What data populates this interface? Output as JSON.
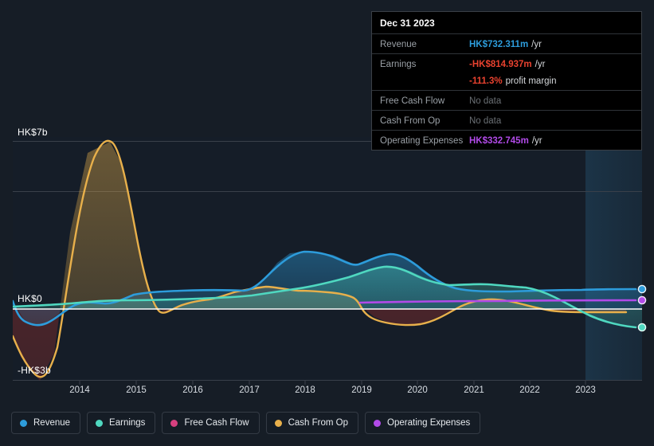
{
  "axes": {
    "y_labels": [
      {
        "text": "HK$7b",
        "value": 7
      },
      {
        "text": "HK$0",
        "value": 0
      },
      {
        "text": "-HK$3b",
        "value": -3
      }
    ],
    "x_labels": [
      "2014",
      "2015",
      "2016",
      "2017",
      "2018",
      "2019",
      "2020",
      "2021",
      "2022",
      "2023"
    ]
  },
  "tooltip": {
    "title": "Dec 31 2023",
    "rows": [
      {
        "key": "Revenue",
        "value": "HK$732.311m",
        "suffix": "/yr",
        "color": "#2d9cdb",
        "nodata": false
      },
      {
        "key": "Earnings",
        "value": "-HK$814.937m",
        "suffix": "/yr",
        "color": "#e8422f",
        "nodata": false
      },
      {
        "key": "",
        "value": "-111.3%",
        "suffix": "profit margin",
        "color": "#e8422f",
        "nodata": false,
        "continuation": true
      },
      {
        "key": "Free Cash Flow",
        "value": "No data",
        "suffix": "",
        "color": "#6b7075",
        "nodata": true
      },
      {
        "key": "Cash From Op",
        "value": "No data",
        "suffix": "",
        "color": "#6b7075",
        "nodata": true
      },
      {
        "key": "Operating Expenses",
        "value": "HK$332.745m",
        "suffix": "/yr",
        "color": "#b14ae8",
        "nodata": false
      }
    ]
  },
  "legend": [
    {
      "label": "Revenue",
      "color": "#2d9cdb"
    },
    {
      "label": "Earnings",
      "color": "#4fd8c0"
    },
    {
      "label": "Free Cash Flow",
      "color": "#d6407f"
    },
    {
      "label": "Cash From Op",
      "color": "#e8b04b"
    },
    {
      "label": "Operating Expenses",
      "color": "#b14ae8"
    }
  ],
  "colors": {
    "background": "#161d26",
    "plot_background": "#151d28",
    "gridline": "#39404a",
    "zero_line": "#ffffff",
    "forecast_band": "#1b3040"
  },
  "chart_data": {
    "type": "area",
    "title": "",
    "xlabel": "",
    "ylabel": "HK$",
    "ylim": [
      -3,
      7.6
    ],
    "xlim": [
      2013.4,
      2023.9
    ],
    "grid": true,
    "legend_position": "bottom",
    "units": "HK$ billions",
    "forecast_start": 2022.8,
    "x": [
      2013.4,
      2013.6,
      2013.8,
      2014.0,
      2014.25,
      2014.5,
      2014.75,
      2015.0,
      2015.25,
      2015.5,
      2015.75,
      2016.0,
      2016.5,
      2017.0,
      2017.5,
      2017.75,
      2018.0,
      2018.5,
      2019.0,
      2019.4,
      2019.7,
      2020.0,
      2020.5,
      2021.0,
      2021.5,
      2022.0,
      2022.5,
      2023.0,
      2023.5,
      2023.85
    ],
    "series": [
      {
        "name": "Revenue",
        "color": "#2d9cdb",
        "values": [
          0.35,
          -0.45,
          -0.72,
          -0.55,
          -0.15,
          0.22,
          0.33,
          0.35,
          0.22,
          0.3,
          0.55,
          0.72,
          0.8,
          0.85,
          0.8,
          1.35,
          2.15,
          2.05,
          1.62,
          1.75,
          2.05,
          1.9,
          1.15,
          0.72,
          0.62,
          0.6,
          0.62,
          0.68,
          0.72,
          0.73
        ],
        "end_value": 0.732,
        "end_label": "HK$732.311m"
      },
      {
        "name": "Earnings",
        "color": "#4fd8c0",
        "values": [
          0.1,
          0.12,
          0.14,
          0.16,
          0.18,
          0.22,
          0.24,
          0.24,
          0.22,
          0.22,
          0.24,
          0.26,
          0.28,
          0.3,
          0.32,
          0.38,
          0.45,
          0.52,
          0.7,
          0.88,
          0.95,
          0.86,
          0.62,
          0.5,
          0.58,
          0.62,
          0.48,
          0.1,
          -0.55,
          -0.815
        ],
        "end_value": -0.815,
        "end_label": "-HK$814.937m"
      },
      {
        "name": "Free Cash Flow",
        "color": "#d6407f",
        "values": [],
        "no_data": true
      },
      {
        "name": "Cash From Op",
        "color": "#e8b04b",
        "values": [
          -1.15,
          -1.85,
          -2.25,
          -2.55,
          -1.45,
          3.2,
          7.15,
          6.2,
          2.7,
          -0.25,
          -0.72,
          -0.05,
          0.3,
          0.35,
          0.55,
          0.72,
          0.88,
          0.8,
          0.78,
          0.05,
          -0.55,
          -0.68,
          -0.45,
          0.1,
          0.32,
          0.25,
          -0.05,
          -0.22,
          -0.2,
          -0.2
        ],
        "no_data_current": true
      },
      {
        "name": "Operating Expenses",
        "color": "#b14ae8",
        "start_x": 2019.35,
        "values_from_start": [
          0.2,
          0.22,
          0.24,
          0.26,
          0.28,
          0.3,
          0.31,
          0.32,
          0.33,
          0.333
        ],
        "end_value": 0.333,
        "end_label": "HK$332.745m"
      }
    ]
  }
}
